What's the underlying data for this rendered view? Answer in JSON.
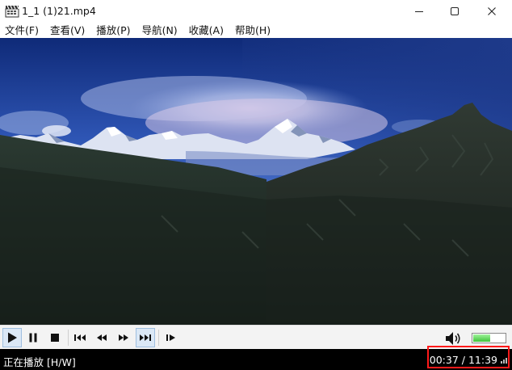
{
  "window": {
    "title": "1_1 (1)21.mp4"
  },
  "menu": {
    "items": [
      "文件(F)",
      "查看(V)",
      "播放(P)",
      "导航(N)",
      "收藏(A)",
      "帮助(H)"
    ]
  },
  "controls": {
    "buttons": [
      "play",
      "pause",
      "stop",
      "skip-back",
      "rewind",
      "fast-forward",
      "skip-forward",
      "frame-step"
    ],
    "active": [
      "play",
      "skip-forward"
    ],
    "volume_level": 0.5
  },
  "status": {
    "state": "正在播放 [H/W]",
    "time": "00:37 / 11:39"
  },
  "colors": {
    "accent_highlight": "#ff1a1a",
    "volume_fill": "#3ec43a",
    "status_bg": "#000000"
  }
}
